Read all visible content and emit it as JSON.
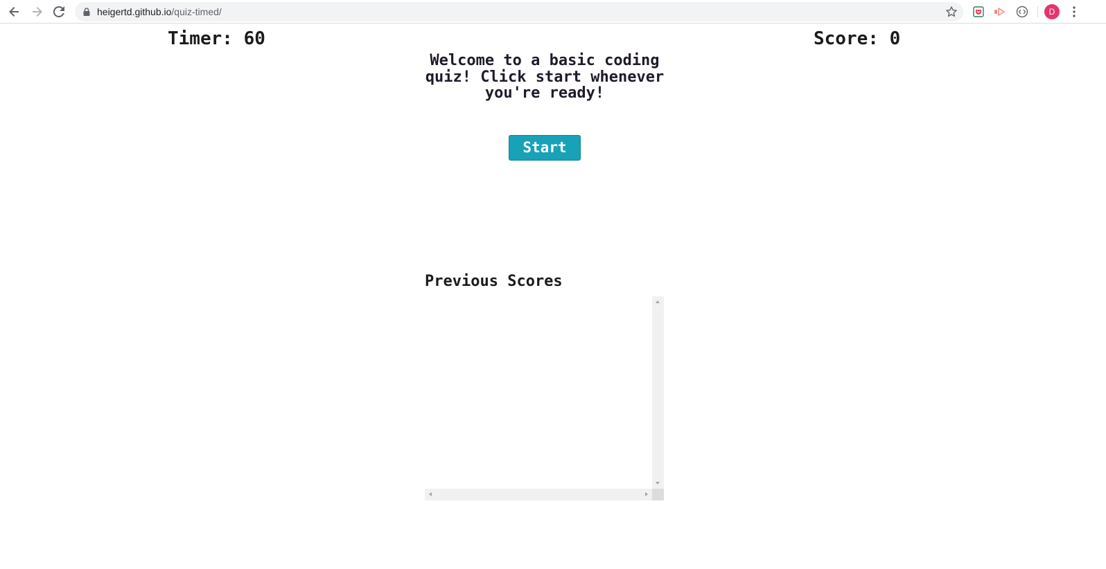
{
  "browser": {
    "url_host": "heigertd.github.io",
    "url_path": "/quiz-timed/",
    "profile_initial": "D",
    "icons": {
      "back": "back-arrow-icon",
      "forward": "forward-arrow-icon",
      "reload": "reload-icon",
      "lock": "lock-icon",
      "bookmark": "star-icon",
      "ext1": "pocket-extension-icon",
      "ext2": "share-extension-icon",
      "ext3": "code-extension-icon",
      "menu": "more-vertical-icon"
    },
    "colors": {
      "avatar": "#e8336d",
      "pocket": "#ef4056"
    }
  },
  "header": {
    "timer_text": "Timer: 60",
    "score_text": "Score: 0"
  },
  "main": {
    "welcome_text": "Welcome to a basic coding quiz! Click start whenever you're ready!",
    "start_label": "Start",
    "start_color": "#17a2b8"
  },
  "scores": {
    "title": "Previous Scores",
    "items": []
  }
}
